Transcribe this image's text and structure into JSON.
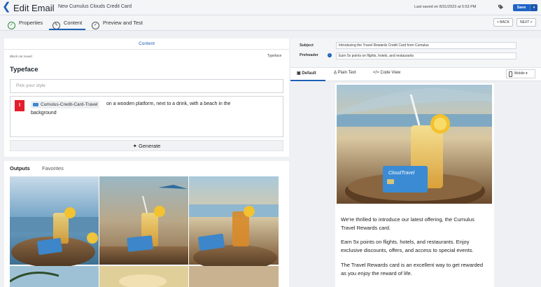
{
  "header": {
    "title": "Edit Email",
    "email_name": "New Cumulus Clouds Credit Card",
    "last_saved": "Last saved on 8/31/2023 at 5:53 PM",
    "save_label": "Save"
  },
  "tabs": [
    {
      "label": "Properties"
    },
    {
      "label": "Content"
    },
    {
      "label": "Preview and Test"
    }
  ],
  "nav": {
    "back": "< BACK",
    "next": "NEXT >"
  },
  "left": {
    "section_title": "Content",
    "block_note": "Block not saved",
    "typeface_link": "Typeface",
    "heading": "Typeface",
    "style_placeholder": "Pick your style",
    "chip_label": "Cumulus-Credit-Card-Travel",
    "prompt_text_1": "on a wooden platform, next to a drink, with a beach in the",
    "prompt_text_2": "background",
    "generate_label": "Generate",
    "outputs_tab": "Outputs",
    "favorites_tab": "Favorites"
  },
  "right": {
    "subject_label": "Subject",
    "subject_value": "Introducing the Travel Rewards Credit Card from Cumulus",
    "preheader_label": "Preheader",
    "preheader_value": "Earn 5x points on flights, hotels, and restaurants",
    "view_tabs": [
      {
        "label": "Default"
      },
      {
        "label": "Plain Text"
      },
      {
        "label": "Code View"
      }
    ],
    "device": "Mobile",
    "card_brand": "CloudTravel",
    "paragraphs": [
      "We're thrilled to introduce our latest offering, the Cumulus Travel Rewards card.",
      "Earn 5x points on flights, hotels, and restaurants. Enjoy exclusive discounts, offers, and access to special events.",
      "The Travel Rewards card is an excellent way to get rewarded as you enjoy the reward of life."
    ]
  },
  "colors": {
    "accent": "#1b5fb5",
    "save": "#1f63c6",
    "badge": "#e41e2b"
  },
  "icons": [
    "back-arrow-icon",
    "tag-icon",
    "properties-icon",
    "pencil-icon",
    "check-circle-icon",
    "magic-wand-icon",
    "info-icon",
    "monitor-icon",
    "text-icon",
    "code-icon",
    "mobile-icon"
  ]
}
